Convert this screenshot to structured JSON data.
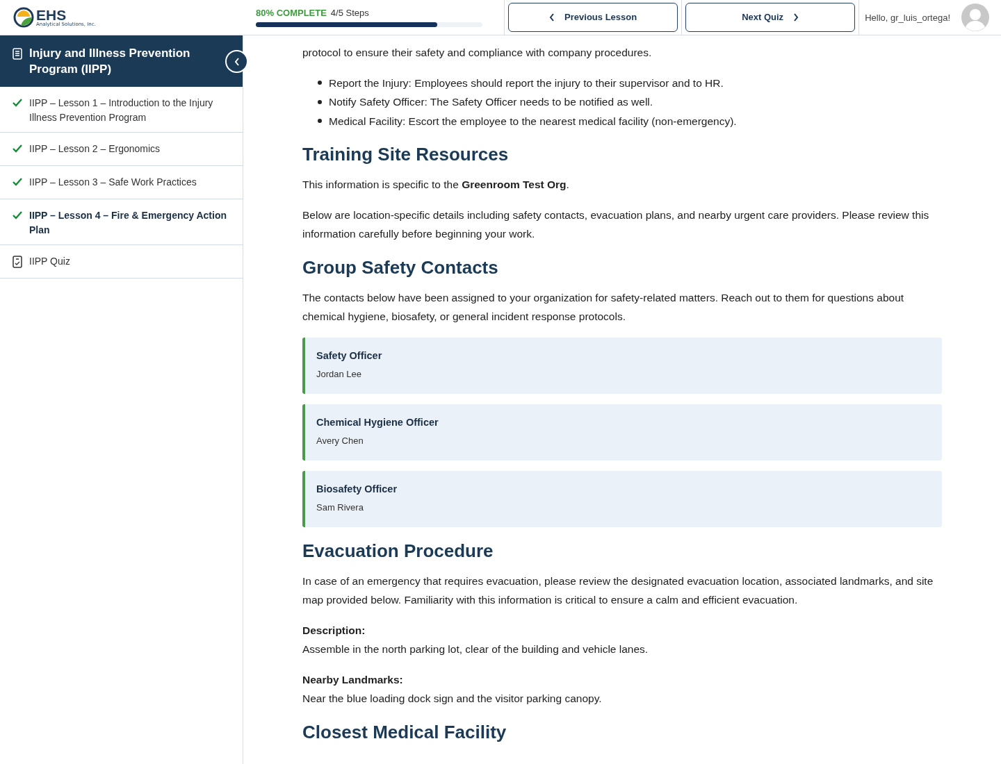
{
  "header": {
    "logo": {
      "name": "EHS",
      "tagline": "Analytical Solutions, Inc."
    },
    "progress": {
      "percent_label": "80% COMPLETE",
      "steps": "4/5 Steps",
      "level": 0.8
    },
    "buttons": [
      {
        "kind": "prev",
        "label": "Previous Lesson"
      },
      {
        "kind": "next",
        "label": "Next Quiz"
      }
    ],
    "greeting": "Hello, gr_luis_ortega!"
  },
  "sidebar": {
    "title": "Injury and Illness Prevention Program (IIPP)",
    "items": [
      {
        "kind": "lesson",
        "label": "IIPP – Lesson 1 – Introduction to the Injury Illness Prevention Program",
        "completed": true,
        "selected": false
      },
      {
        "kind": "lesson",
        "label": "IIPP – Lesson 2 – Ergonomics",
        "completed": true,
        "selected": false
      },
      {
        "kind": "lesson",
        "label": "IIPP – Lesson 3 – Safe Work Practices",
        "completed": true,
        "selected": false
      },
      {
        "kind": "lesson",
        "label": "IIPP – Lesson 4 – Fire & Emergency Action Plan",
        "completed": true,
        "selected": true
      },
      {
        "kind": "quiz",
        "label": "IIPP Quiz",
        "selected": false
      }
    ]
  },
  "content": [
    {
      "kind": "paragraph",
      "text": "protocol to ensure their safety and compliance with company procedures."
    },
    {
      "kind": "list",
      "items": [
        "Report the Injury: Employees should report the injury to their supervisor and to HR.",
        "Notify Safety Officer: The Safety Officer needs to be notified as well.",
        "Medical Facility: Escort the employee to the nearest medical facility (non-emergency)."
      ]
    },
    {
      "kind": "heading",
      "text": "Training Site Resources"
    },
    {
      "kind": "paragraph",
      "text": "This information is specific to the **Greenroom Test Org**."
    },
    {
      "kind": "paragraph",
      "text": "Below are location-specific details including safety contacts, evacuation plans, and nearby urgent care providers. Please review this information carefully before beginning your work."
    },
    {
      "kind": "heading",
      "text": "Group Safety Contacts"
    },
    {
      "kind": "paragraph",
      "text": "The contacts below have been assigned to your organization for safety-related matters. Reach out to them for questions about chemical hygiene, biosafety, or general incident response protocols."
    },
    {
      "kind": "contacts",
      "items": [
        {
          "role": "Safety Officer",
          "name": "Jordan Lee"
        },
        {
          "role": "Chemical Hygiene Officer",
          "name": "Avery Chen"
        },
        {
          "role": "Biosafety Officer",
          "name": "Sam Rivera"
        }
      ]
    },
    {
      "kind": "heading",
      "text": "Evacuation Procedure"
    },
    {
      "kind": "paragraph",
      "text": "In case of an emergency that requires evacuation, please review the designated evacuation location, associated landmarks, and site map provided below. Familiarity with this information is critical to ensure a calm and efficient evacuation."
    },
    {
      "kind": "field",
      "label": "Description:",
      "text": "Assemble in the north parking lot, clear of the building and vehicle lanes."
    },
    {
      "kind": "field",
      "label": "Nearby Landmarks:",
      "text": "Near the blue loading dock sign and the visitor parking canopy."
    },
    {
      "kind": "heading",
      "text": "Closest Medical Facility"
    }
  ]
}
